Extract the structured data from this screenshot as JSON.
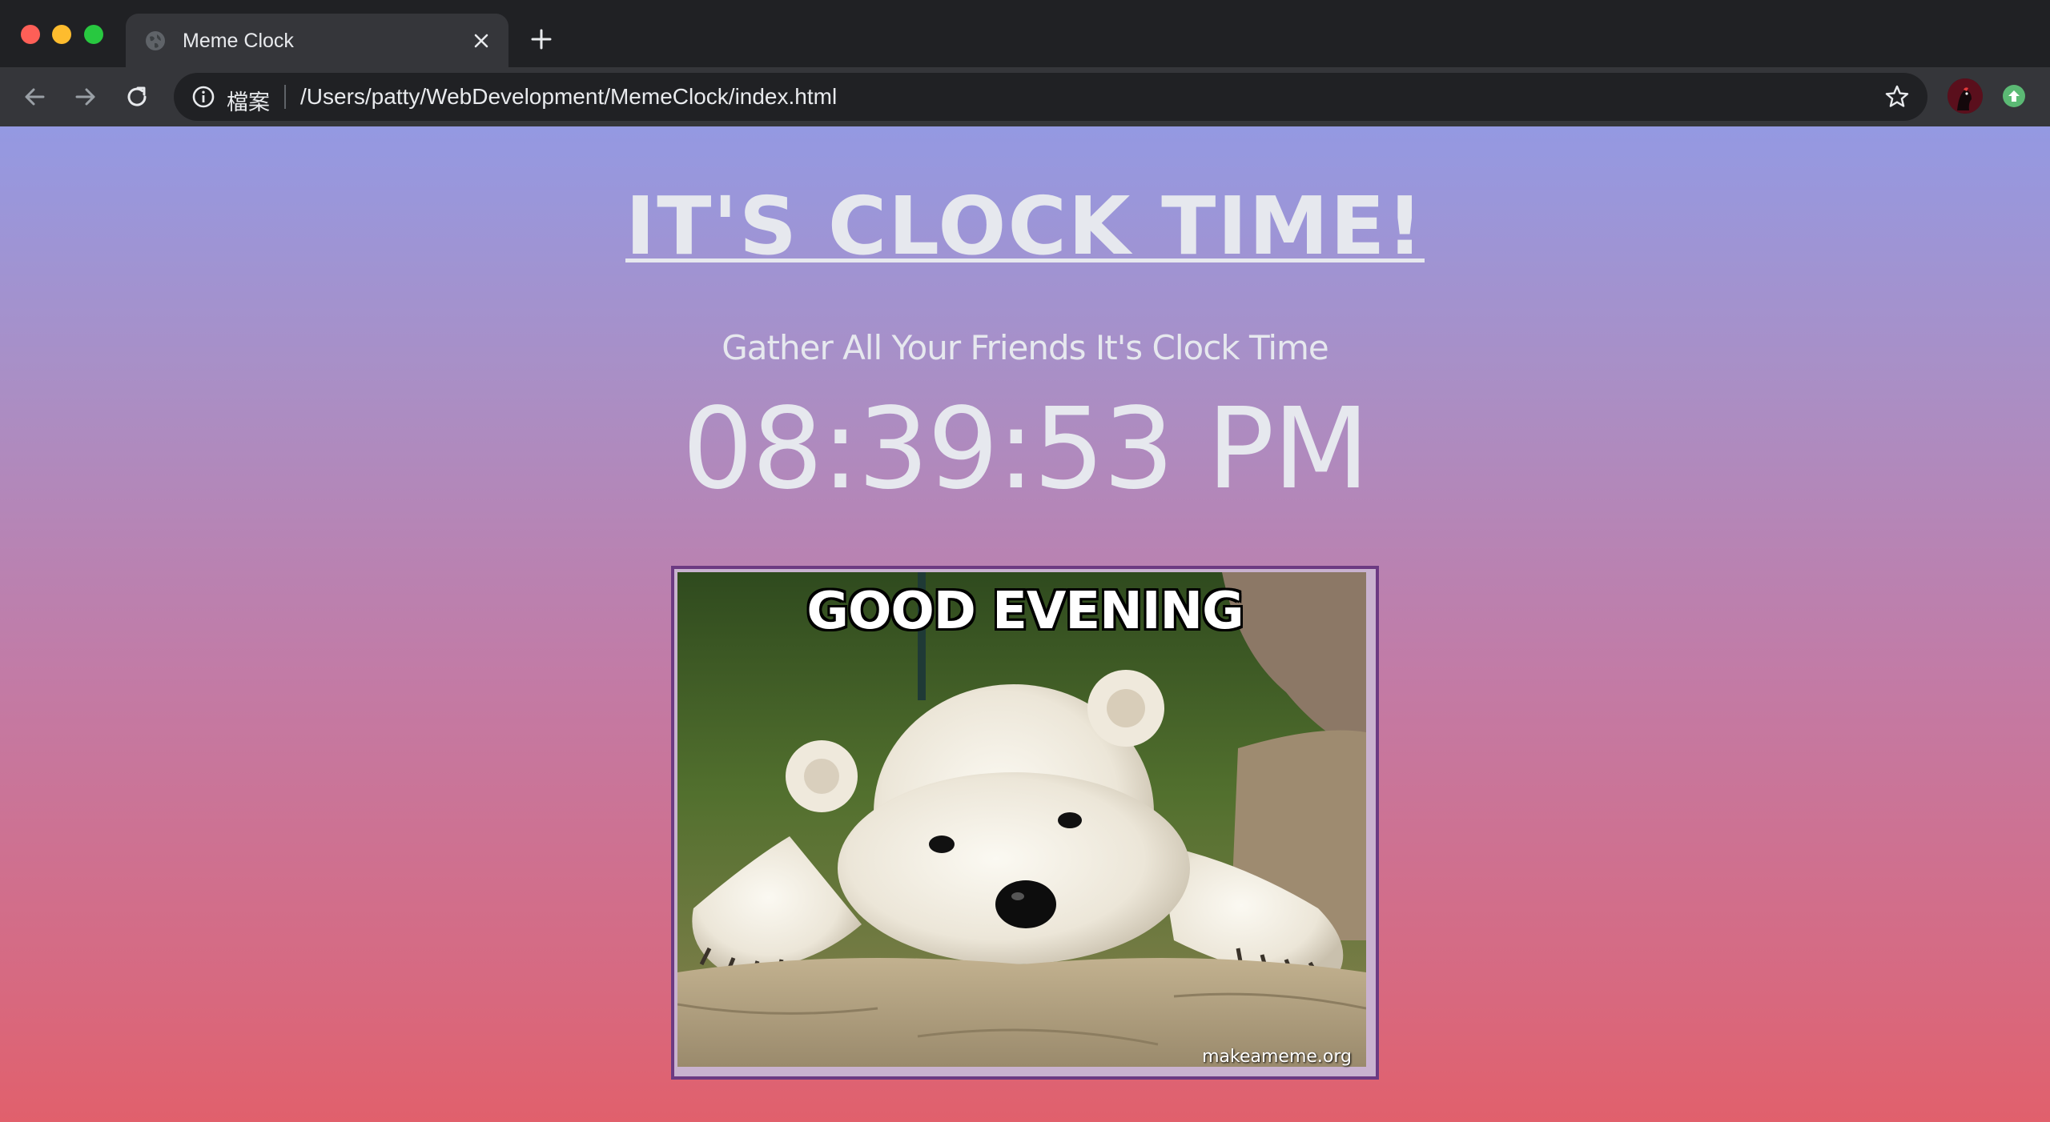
{
  "browser": {
    "tab": {
      "title": "Meme Clock"
    },
    "omnibox": {
      "scheme_label": "檔案",
      "url": "/Users/patty/WebDevelopment/MemeClock/index.html"
    }
  },
  "page": {
    "title": "IT'S CLOCK TIME!",
    "subtitle": "Gather All Your Friends It's Clock Time",
    "clock": "08:39:53 PM",
    "meme": {
      "caption": "GOOD EVENING",
      "watermark": "makeameme.org"
    }
  },
  "colors": {
    "gradient_top": "#9499e2",
    "gradient_bottom": "#e1606c",
    "text": "#e6e8ee",
    "meme_border": "#6c3a82"
  }
}
